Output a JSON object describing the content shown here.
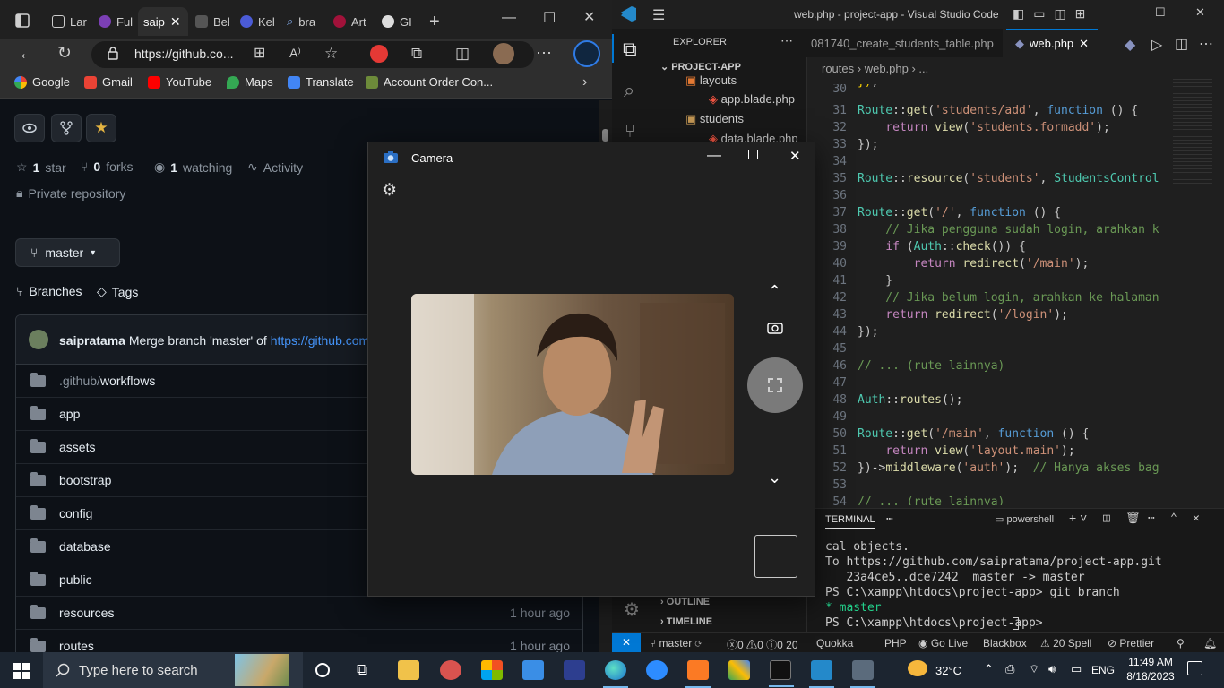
{
  "browser": {
    "tabs": [
      "Lar",
      "Ful",
      "saip",
      "Bel",
      "Kel",
      "bra",
      "Art",
      "GI"
    ],
    "url": "https://github.co...",
    "bookmarks": [
      "Google",
      "Gmail",
      "YouTube",
      "Maps",
      "Translate",
      "Account Order Con..."
    ]
  },
  "repo": {
    "stars_count": "1",
    "stars_label": "star",
    "forks_count": "0",
    "forks_label": "forks",
    "watching_count": "1",
    "watching_label": "watching",
    "activity": "Activity",
    "visibility": "Private repository",
    "branch": "master",
    "branches_label": "Branches",
    "tags_label": "Tags",
    "commit_author": "saipratama",
    "commit_message": "Merge branch 'master' of",
    "commit_link": "https://github.com",
    "files": [
      {
        "prefix": ".github/",
        "name": "workflows",
        "time": ""
      },
      {
        "prefix": "",
        "name": "app",
        "time": ""
      },
      {
        "prefix": "",
        "name": "assets",
        "time": ""
      },
      {
        "prefix": "",
        "name": "bootstrap",
        "time": ""
      },
      {
        "prefix": "",
        "name": "config",
        "time": ""
      },
      {
        "prefix": "",
        "name": "database",
        "time": ""
      },
      {
        "prefix": "",
        "name": "public",
        "time": ""
      },
      {
        "prefix": "",
        "name": "resources",
        "time": "1 hour ago"
      },
      {
        "prefix": "",
        "name": "routes",
        "time": "1 hour ago"
      }
    ]
  },
  "camera": {
    "title": "Camera"
  },
  "vscode": {
    "title": "web.php - project-app - Visual Studio Code",
    "explorer_label": "EXPLORER",
    "project": "PROJECT-APP",
    "tree": [
      "layouts",
      "app.blade.php",
      "students",
      "data.blade.php"
    ],
    "outline": "OUTLINE",
    "timeline": "TIMELINE",
    "tab_inactive": "081740_create_students_table.php",
    "tab_active": "web.php",
    "breadcrumb": [
      "routes",
      "web.php",
      "..."
    ],
    "terminal_label": "TERMINAL",
    "shell": "powershell",
    "terminal_lines": [
      "cal objects.",
      "To https://github.com/saipratama/project-app.git",
      "   23a4ce5..dce7242  master -> master",
      "PS C:\\xampp\\htdocs\\project-app> git branch",
      "* master",
      "PS C:\\xampp\\htdocs\\project-app> "
    ],
    "status": {
      "branch": "master",
      "problems": "0",
      "warnings": "0",
      "info": "0",
      "ports": "20",
      "quokka": "Quokka",
      "lang": "PHP",
      "golive": "Go Live",
      "blackbox": "Blackbox",
      "spell": "20 Spell",
      "prettier": "Prettier"
    }
  },
  "taskbar": {
    "search_placeholder": "Type here to search",
    "temperature": "32°C",
    "language": "ENG",
    "time": "11:49 AM",
    "date": "8/18/2023"
  }
}
